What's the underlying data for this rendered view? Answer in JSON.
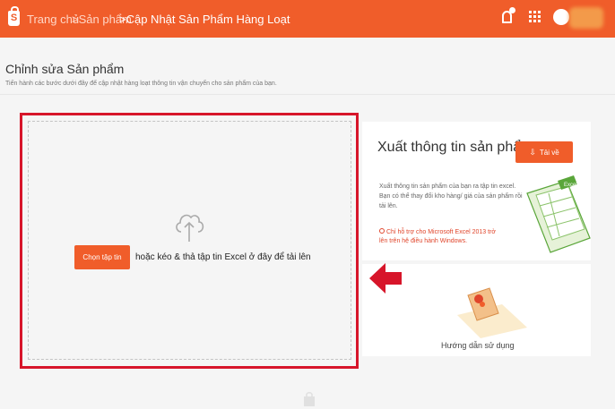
{
  "header": {
    "logo_glyph": "S",
    "breadcrumb": {
      "home": "Trang chủ",
      "products": ">Sản phẩm",
      "current": ">Cập Nhật Sản Phẩm Hàng Loạt"
    },
    "icons": [
      "notification-bell-icon",
      "apps-grid-icon",
      "user-avatar-icon"
    ],
    "accent_color": "#f05d2a"
  },
  "page": {
    "title": "Chỉnh sửa Sản phẩm",
    "description": "Tiến hành các bước dưới đây để cập nhật hàng loạt thông tin vận chuyển cho sản phẩm của bạn."
  },
  "upload": {
    "choose_button": "Chọn tập tin",
    "drop_text": "hoặc kéo & thả tập tin Excel ở đây để tải lên",
    "highlight_color": "#d7152a"
  },
  "export": {
    "title": "Xuất thông tin sản phẩm",
    "download_button": "Tải về",
    "description": "Xuất thông tin sản phẩm của bạn ra tập tin excel. Bạn có thể thay đổi kho hàng/ giá của sản phẩm rồi tải lên.",
    "support_note": "Chỉ hỗ trợ cho Microsoft Excel 2013 trở lên trên hệ điều hành Windows.",
    "art_label": "Excel"
  },
  "guide": {
    "label": "Hướng dẫn sử dụng"
  }
}
